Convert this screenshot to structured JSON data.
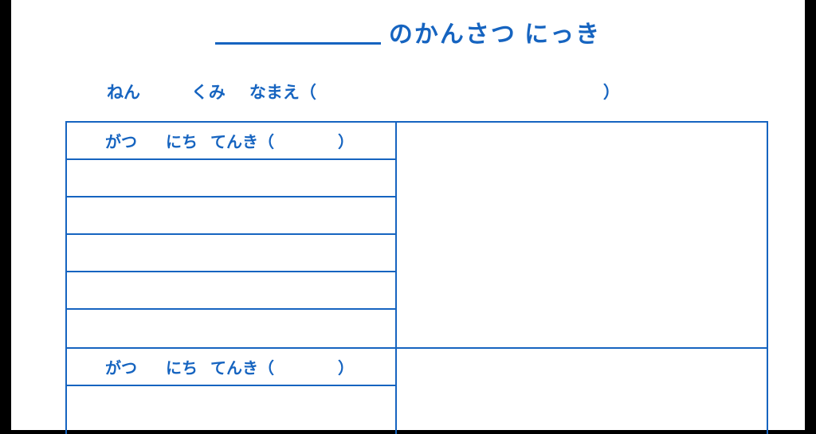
{
  "title": {
    "suffix": "のかんさつ にっき"
  },
  "header": {
    "year_label": "ねん",
    "class_label": "くみ",
    "name_label": "なまえ",
    "open_paren": "（",
    "close_paren": "）"
  },
  "entry": {
    "month_label": "がつ",
    "day_label": "にち",
    "weather_label": "てんき",
    "open_paren": "（",
    "close_paren": "）"
  }
}
